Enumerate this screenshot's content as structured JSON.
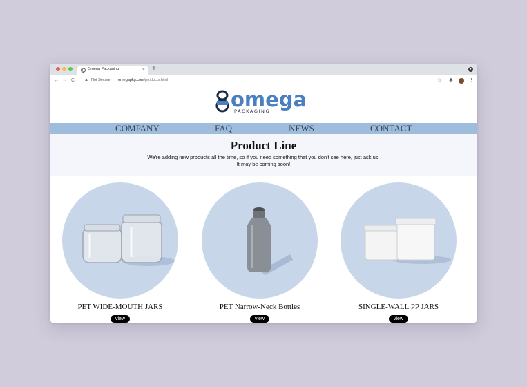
{
  "browser": {
    "tab_title": "Omega Packaging",
    "tab_close": "×",
    "new_tab": "+",
    "nav_back": "←",
    "nav_forward": "→",
    "nav_reload": "C",
    "lock_icon": "▲",
    "security_label": "Not Secure",
    "url_domain": "omegapkg.com",
    "url_path": "/products.html",
    "star_icon": "☆",
    "extension_icon": "✱",
    "menu_icon": "⋮",
    "window_menu_icon": "▾"
  },
  "site": {
    "logo_text": "omega",
    "logo_subtext": "PACKAGING",
    "nav": [
      "COMPANY",
      "FAQ",
      "NEWS",
      "CONTACT"
    ]
  },
  "intro": {
    "title": "Product Line",
    "line1": "We're adding new products all the time, so if you need something that you don't see here, just ask us.",
    "line2": "It may be coming soon!"
  },
  "products": [
    {
      "name": "PET WIDE-MOUTH JARS",
      "button": "view"
    },
    {
      "name": "PET Narrow-Neck Bottles",
      "button": "view"
    },
    {
      "name": "SINGLE-WALL PP JARS",
      "button": "view"
    }
  ],
  "colors": {
    "nav_bar": "#9ebcdc",
    "circle": "#c8d6ea",
    "logo_blue": "#4a7fc1"
  }
}
